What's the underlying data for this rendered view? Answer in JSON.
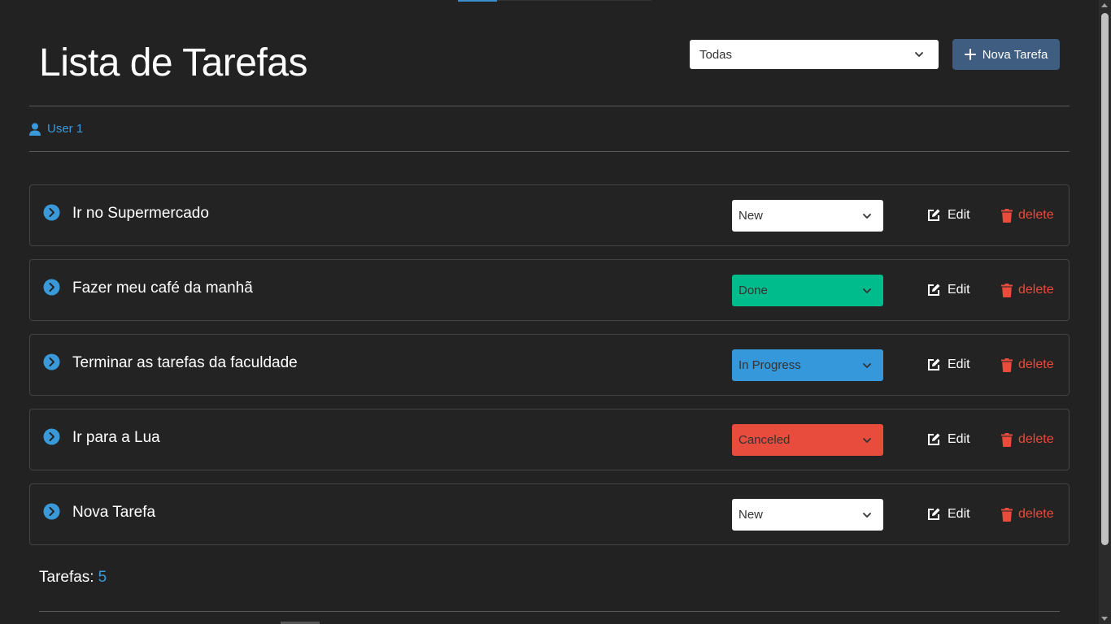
{
  "header": {
    "title": "Lista de Tarefas",
    "filter": {
      "selected": "Todas"
    },
    "new_task_label": "Nova Tarefa"
  },
  "user": {
    "name": "User 1"
  },
  "tasks": [
    {
      "title": "Ir no Supermercado",
      "status": "New",
      "edit_label": "Edit",
      "delete_label": "delete"
    },
    {
      "title": "Fazer meu café da manhã",
      "status": "Done",
      "edit_label": "Edit",
      "delete_label": "delete"
    },
    {
      "title": "Terminar as tarefas da faculdade",
      "status": "In Progress",
      "edit_label": "Edit",
      "delete_label": "delete"
    },
    {
      "title": "Ir para a Lua",
      "status": "Canceled",
      "edit_label": "Edit",
      "delete_label": "delete"
    },
    {
      "title": "Nova Tarefa",
      "status": "New",
      "edit_label": "Edit",
      "delete_label": "delete"
    }
  ],
  "footer": {
    "count_label": "Tarefas:",
    "count_value": "5"
  },
  "colors": {
    "background": "#222222",
    "accent": "#3a9ad9",
    "primary_button": "#3e5d80",
    "status_new": "#ffffff",
    "status_done": "#00bb8c",
    "status_in_progress": "#3498db",
    "status_canceled": "#e74c3c",
    "delete": "#e74c3c"
  }
}
